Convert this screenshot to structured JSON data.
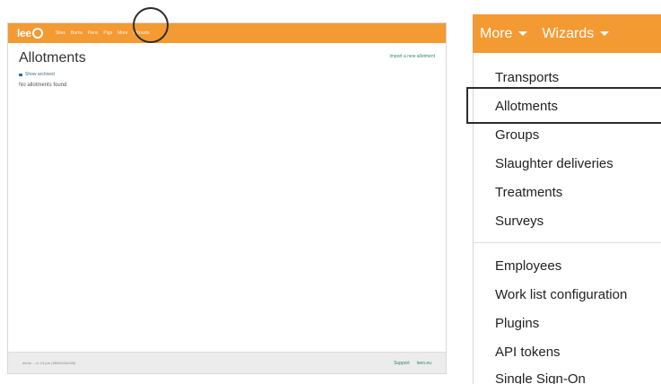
{
  "app": {
    "logo_text": "lee",
    "nav_links": [
      "Sites",
      "Barns",
      "Pens",
      "Pigs",
      "More",
      "Wizards"
    ]
  },
  "page": {
    "title": "Allotments",
    "import_link": "Import a new allotment",
    "show_archived": "Show archived",
    "empty_message": "No allotments found"
  },
  "footer": {
    "version": "demo – v1.13.pre (9806043a335)",
    "support": "Support",
    "site": "leeo.eu"
  },
  "zoom": {
    "nav_more": "More",
    "nav_wizards": "Wizards",
    "menu_group1": [
      "Transports",
      "Allotments",
      "Groups",
      "Slaughter deliveries",
      "Treatments",
      "Surveys"
    ],
    "menu_group2": [
      "Employees",
      "Work list configuration",
      "Plugins",
      "API tokens",
      "Single Sign-On"
    ]
  },
  "colors": {
    "brand_orange": "#f39a33",
    "link_green": "#2b8a6f"
  }
}
